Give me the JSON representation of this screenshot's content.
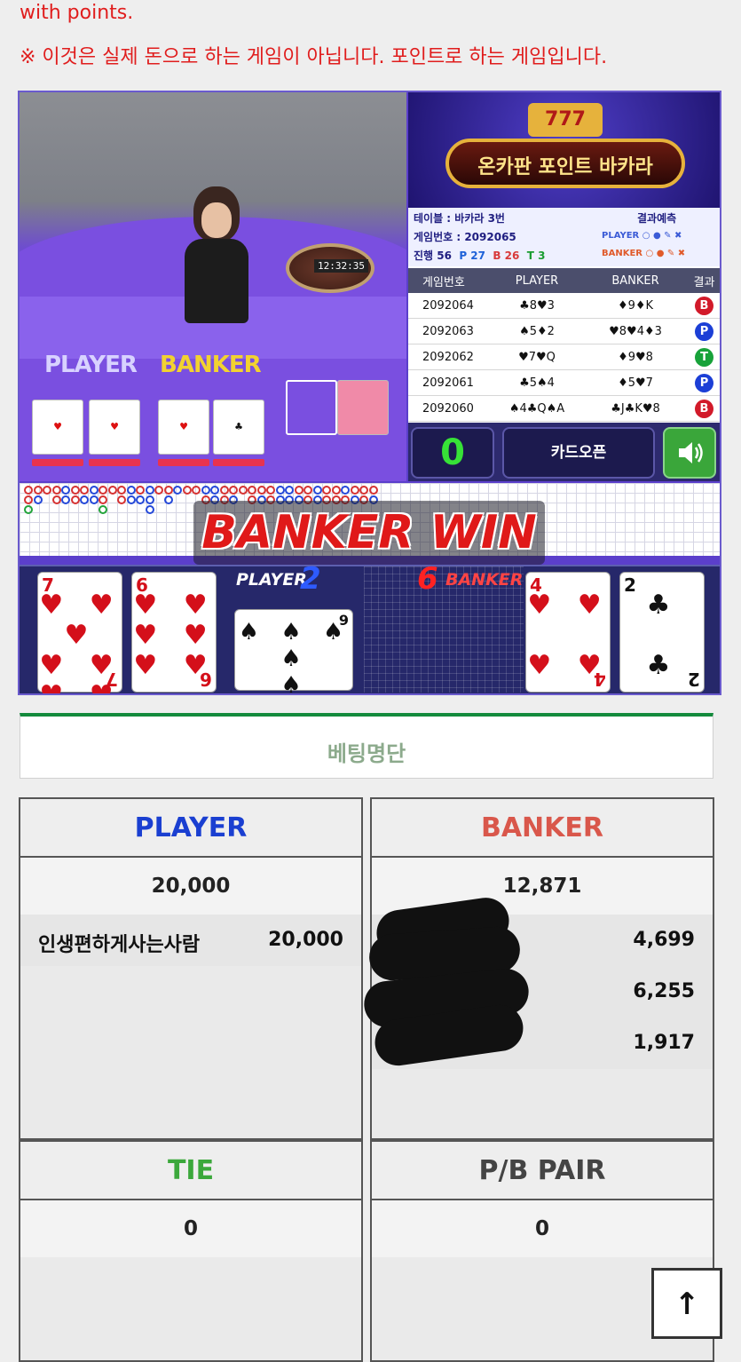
{
  "notice": {
    "line1": "with points.",
    "line2": "※ 이것은 실제 돈으로 하는 게임이 아닙니다. 포인트로 하는 게임입니다."
  },
  "video": {
    "player_label": "PLAYER",
    "banker_label": "BANKER",
    "clock": "12:32:35"
  },
  "banner": {
    "slot": "777",
    "title": "온카판 포인트 바카라"
  },
  "info": {
    "table_label": "테이블 : 바카라 3번",
    "game_label": "게임번호 : 2092065",
    "progress_label": "진행 56",
    "p_count": "P 27",
    "b_count": "B 26",
    "t_count": "T 3",
    "predict_title": "결과예측",
    "predict_player": "PLAYER ○ ● ✎ ✖",
    "predict_banker": "BANKER ○ ● ✎ ✖"
  },
  "results": {
    "headers": [
      "게임번호",
      "PLAYER",
      "BANKER",
      "결과"
    ],
    "rows": [
      {
        "game": "2092064",
        "player": "♣8♥3",
        "banker": "♦9♦K",
        "result": "B"
      },
      {
        "game": "2092063",
        "player": "♠5♦2",
        "banker": "♥8♥4♦3",
        "result": "P"
      },
      {
        "game": "2092062",
        "player": "♥7♥Q",
        "banker": "♦9♥8",
        "result": "T"
      },
      {
        "game": "2092061",
        "player": "♣5♠4",
        "banker": "♦5♥7",
        "result": "P"
      },
      {
        "game": "2092060",
        "player": "♠4♣Q♠A",
        "banker": "♣J♣K♥8",
        "result": "B"
      }
    ]
  },
  "controls": {
    "countdown": "0",
    "card_open": "카드오픈",
    "sound_icon": "speaker-icon"
  },
  "win_text": "BANKER WIN",
  "cards": {
    "player_label": "PLAYER",
    "player_score": "2",
    "banker_score": "6",
    "banker_label": "BANKER",
    "player_cards": [
      {
        "rank": "7",
        "suit": "♥",
        "color": "red"
      },
      {
        "rank": "6",
        "suit": "♥",
        "color": "red"
      },
      {
        "rank": "9",
        "suit": "♠",
        "color": "black"
      }
    ],
    "banker_cards": [
      {
        "rank": "4",
        "suit": "♥",
        "color": "red"
      },
      {
        "rank": "2",
        "suit": "♣",
        "color": "black"
      }
    ]
  },
  "betting": {
    "title": "베팅명단",
    "player": {
      "label": "PLAYER",
      "total": "20,000",
      "rows": [
        {
          "name": "인생편하게사는사람",
          "amount": "20,000"
        }
      ]
    },
    "banker": {
      "label": "BANKER",
      "total": "12,871",
      "rows": [
        {
          "name": "",
          "amount": "4,699"
        },
        {
          "name": "",
          "amount": "6,255"
        },
        {
          "name": "",
          "amount": "1,917"
        }
      ]
    },
    "tie": {
      "label": "TIE",
      "total": "0"
    },
    "pair": {
      "label": "P/B PAIR",
      "total": "0"
    }
  },
  "scroll_top": "↑"
}
